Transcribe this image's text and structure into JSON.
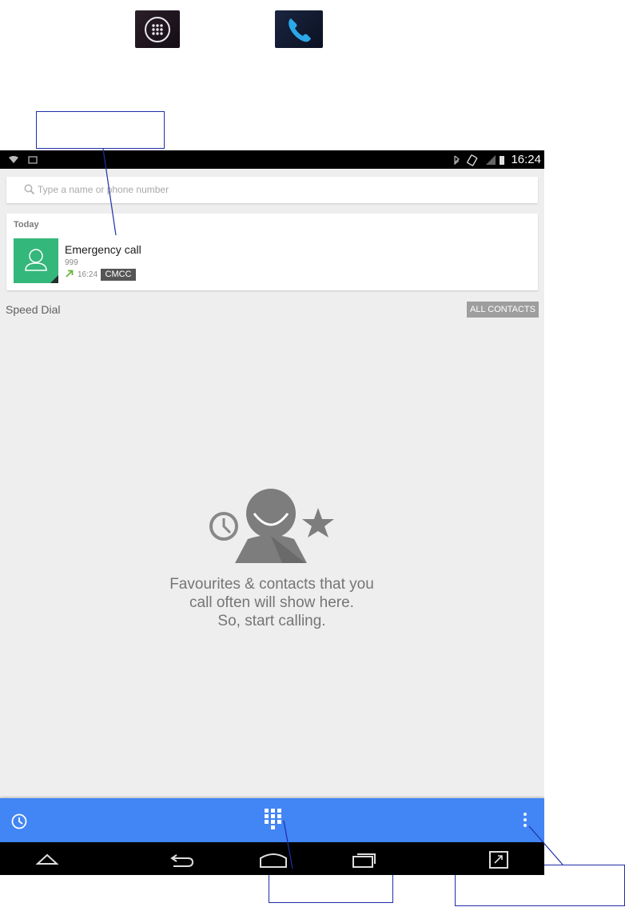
{
  "status_bar": {
    "time": "16:24"
  },
  "search": {
    "placeholder": "Type a name or phone number"
  },
  "recent": {
    "section_label": "Today",
    "items": [
      {
        "name": "Emergency call",
        "number": "999",
        "time": "16:24",
        "carrier": "CMCC",
        "call_type": "outgoing"
      }
    ]
  },
  "speed_dial": {
    "label": "Speed Dial",
    "all_contacts_label": "ALL CONTACTS",
    "empty_lines": [
      "Favourites & contacts that you",
      "call often will show here.",
      "So, start calling."
    ]
  },
  "colors": {
    "action_bar": "#4285f4",
    "avatar": "#34b77a",
    "screen_background": "#eeeeee",
    "callout_border": "#1f2fa8"
  },
  "icons": {
    "launcher": [
      "apps-grid-icon",
      "phone-handset-icon"
    ],
    "action_bar": [
      "history-icon",
      "dialpad-icon",
      "overflow-menu-icon"
    ],
    "nav_bar": [
      "back-icon",
      "home-icon",
      "recents-icon",
      "screenshot-icon"
    ]
  }
}
